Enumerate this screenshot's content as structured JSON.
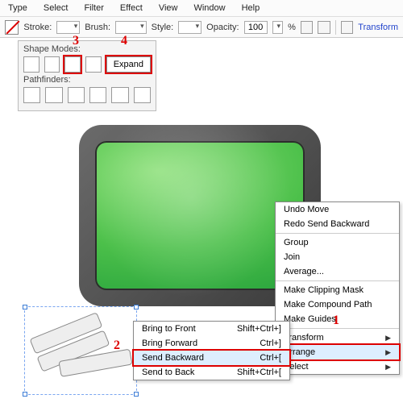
{
  "menu": {
    "type": "Type",
    "select": "Select",
    "filter": "Filter",
    "effect": "Effect",
    "view": "View",
    "window": "Window",
    "help": "Help"
  },
  "toolbar": {
    "stroke": "Stroke:",
    "brush": "Brush:",
    "style": "Style:",
    "opacity": "Opacity:",
    "opval": "100",
    "pct": "%",
    "transform": "Transform"
  },
  "panel": {
    "shapemodes": "Shape Modes:",
    "expand": "Expand",
    "pathfinders": "Pathfinders:"
  },
  "callouts": {
    "c1": "1",
    "c2": "2",
    "c3": "3",
    "c4": "4"
  },
  "cm1": {
    "undo": "Undo Move",
    "redo": "Redo Send Backward",
    "group": "Group",
    "join": "Join",
    "avg": "Average...",
    "clip": "Make Clipping Mask",
    "comp": "Make Compound Path",
    "guides": "Make Guides",
    "transform": "Transform",
    "arrange": "Arrange",
    "select": "Select"
  },
  "cm2": {
    "front": {
      "l": "Bring to Front",
      "s": "Shift+Ctrl+]"
    },
    "forward": {
      "l": "Bring Forward",
      "s": "Ctrl+]"
    },
    "backward": {
      "l": "Send Backward",
      "s": "Ctrl+["
    },
    "back": {
      "l": "Send to Back",
      "s": "Shift+Ctrl+["
    }
  }
}
